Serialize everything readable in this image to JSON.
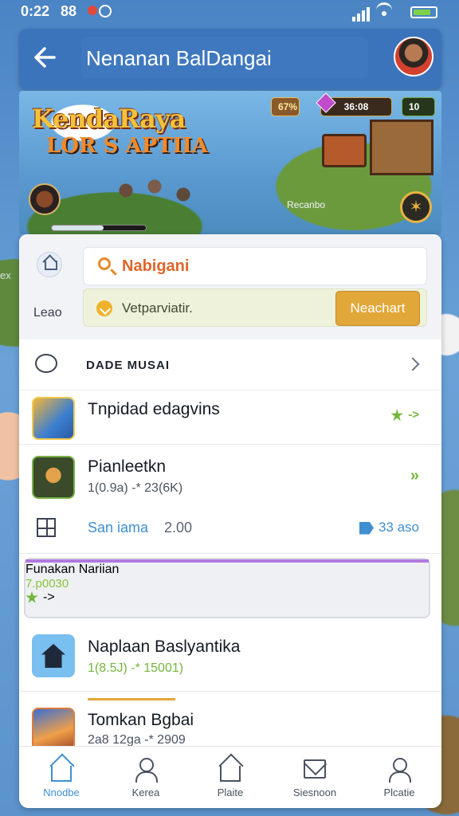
{
  "status_bar": {
    "time": "0:22",
    "indicator": "88",
    "battery_level": 0.8
  },
  "header": {
    "title": "Nenanan BalDangai",
    "back_icon": "arrow-left-icon",
    "avatar_icon": "user-avatar"
  },
  "banner": {
    "game_title": "KendaRaya",
    "game_subtitle": "LOR S APTIIA",
    "resources": {
      "a": "67%",
      "b": "36:08",
      "c": "10"
    },
    "map_label": "Recanbo",
    "progress": 0.55,
    "action_icon": "sword-icon"
  },
  "background_labels": {
    "left": "ex"
  },
  "search": {
    "side_label": "Leao",
    "query": "Nabigani",
    "prompt_text": "Vetparviatir.",
    "cta_label": "Neachart"
  },
  "section": {
    "title": "DADE MUSAI"
  },
  "items": [
    {
      "name": "Tnpidad edagvins",
      "meta": "",
      "action": "->"
    },
    {
      "name": "Pianleetkn",
      "meta": "1(0.9a) -* 23(6K)",
      "action": "»"
    },
    {
      "name": "Funakan Nariian",
      "meta": "7.p0030",
      "action": "->"
    },
    {
      "name": "Naplaan Baslyantika",
      "meta": "1(8.5J) -* 15001)",
      "action": ""
    },
    {
      "name": "Tomkan Bgbai",
      "meta": "2a8 12ga -* 2909",
      "action": ""
    }
  ],
  "stats": {
    "label": "San iama",
    "value": "2.00",
    "right": "33 aso"
  },
  "bottom_nav": [
    {
      "label": "Nnodbe",
      "icon": "home-icon",
      "active": true
    },
    {
      "label": "Kerea",
      "icon": "person-icon",
      "active": false
    },
    {
      "label": "Plaite",
      "icon": "house-icon",
      "active": false
    },
    {
      "label": "Siesnoon",
      "icon": "mail-icon",
      "active": false
    },
    {
      "label": "Plcatie",
      "icon": "profile-icon",
      "active": false
    }
  ],
  "colors": {
    "header": "#3b74bb",
    "accent_orange": "#e2a739",
    "accent_green": "#74b63c",
    "accent_blue": "#3f8fd0"
  }
}
